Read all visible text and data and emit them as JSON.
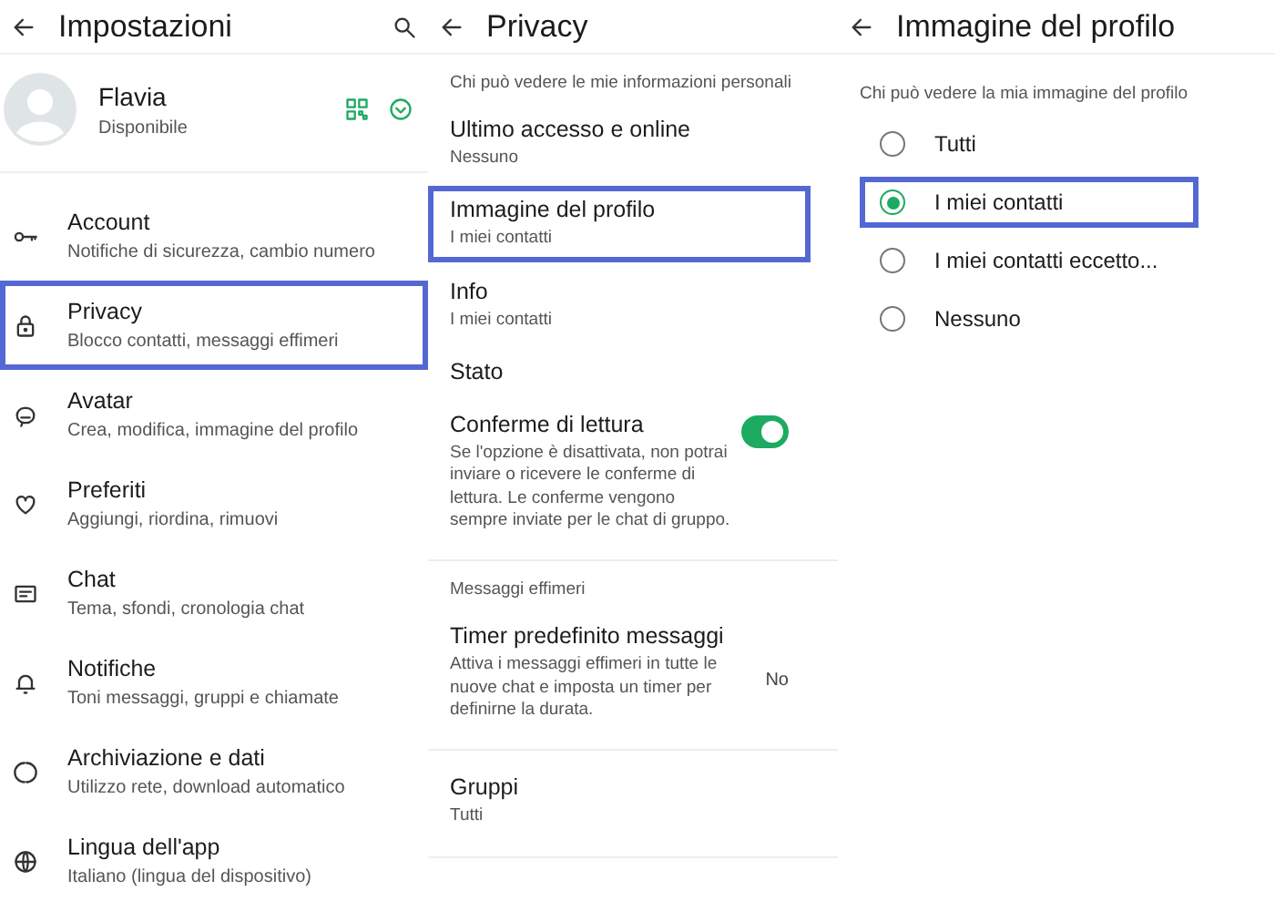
{
  "settings": {
    "title": "Impostazioni",
    "profile": {
      "name": "Flavia",
      "status": "Disponibile"
    },
    "items": [
      {
        "title": "Account",
        "subtitle": "Notifiche di sicurezza, cambio numero",
        "highlighted": false
      },
      {
        "title": "Privacy",
        "subtitle": "Blocco contatti, messaggi effimeri",
        "highlighted": true
      },
      {
        "title": "Avatar",
        "subtitle": "Crea, modifica, immagine del profilo",
        "highlighted": false
      },
      {
        "title": "Preferiti",
        "subtitle": "Aggiungi, riordina, rimuovi",
        "highlighted": false
      },
      {
        "title": "Chat",
        "subtitle": "Tema, sfondi, cronologia chat",
        "highlighted": false
      },
      {
        "title": "Notifiche",
        "subtitle": "Toni messaggi, gruppi e chiamate",
        "highlighted": false
      },
      {
        "title": "Archiviazione e dati",
        "subtitle": "Utilizzo rete, download automatico",
        "highlighted": false
      },
      {
        "title": "Lingua dell'app",
        "subtitle": "Italiano (lingua del dispositivo)",
        "highlighted": false
      }
    ]
  },
  "privacy": {
    "title": "Privacy",
    "sections": [
      {
        "label": "Chi può vedere le mie informazioni personali",
        "items": [
          {
            "kind": "item",
            "title": "Ultimo accesso e online",
            "subtitle": "Nessuno",
            "highlighted": false
          },
          {
            "kind": "item",
            "title": "Immagine del profilo",
            "subtitle": "I miei contatti",
            "highlighted": true
          },
          {
            "kind": "item",
            "title": "Info",
            "subtitle": "I miei contatti",
            "highlighted": false
          },
          {
            "kind": "item",
            "title": "Stato",
            "highlighted": false
          },
          {
            "kind": "toggle",
            "title": "Conferme di lettura",
            "subtitle": "Se l'opzione è disattivata, non potrai inviare o ricevere le conferme di lettura. Le conferme vengono sempre inviate per le chat di gruppo.",
            "on": true,
            "highlighted": false
          }
        ]
      },
      {
        "label": "Messaggi effimeri",
        "items": [
          {
            "kind": "value",
            "title": "Timer predefinito messaggi",
            "subtitle": "Attiva i messaggi effimeri in tutte le nuove chat e imposta un timer per definirne la durata.",
            "value": "No",
            "highlighted": false
          }
        ]
      },
      {
        "items": [
          {
            "kind": "item",
            "title": "Gruppi",
            "subtitle": "Tutti",
            "highlighted": false
          }
        ]
      }
    ]
  },
  "profile_photo": {
    "title": "Immagine del profilo",
    "label": "Chi può vedere la mia immagine del profilo",
    "options": [
      {
        "label": "Tutti",
        "selected": false,
        "highlighted": false
      },
      {
        "label": "I miei contatti",
        "selected": true,
        "highlighted": true
      },
      {
        "label": "I miei contatti eccetto...",
        "selected": false,
        "highlighted": false
      },
      {
        "label": "Nessuno",
        "selected": false,
        "highlighted": false
      }
    ]
  }
}
